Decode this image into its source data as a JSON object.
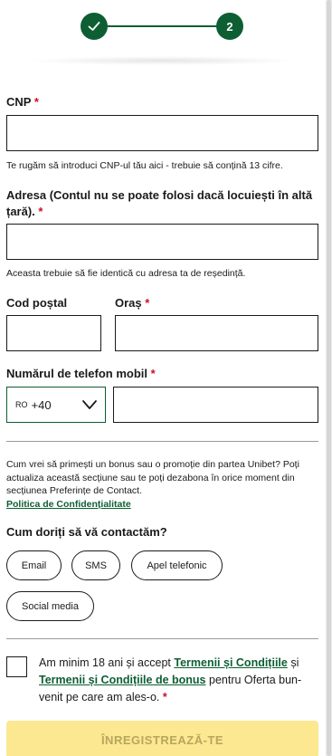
{
  "stepper": {
    "step2_label": "2"
  },
  "cnp": {
    "label": "CNP",
    "required": "*",
    "hint": "Te rugăm să introduci CNP-ul tău aici - trebuie să conțină 13 cifre."
  },
  "address": {
    "label": "Adresa (Contul nu se poate folosi dacă locuiești în altă țară).",
    "required": "*",
    "hint": "Aceasta trebuie să fie identică cu adresa ta de reședință."
  },
  "postal": {
    "label": "Cod poștal"
  },
  "city": {
    "label": "Oraș",
    "required": "*"
  },
  "phone": {
    "label": "Numărul de telefon mobil",
    "required": "*",
    "country_code": "RO",
    "dial_code": "+40"
  },
  "marketing": {
    "info": "Cum vrei să primești un bonus sau o promoție din partea Unibet? Poți actualiza această secțiune sau te poți dezabona în orice moment din secțiunea Preferințe de Contact.",
    "privacy_link": "Politica de Confidențialitate",
    "question": "Cum doriți să vă contactăm?",
    "options": [
      "Email",
      "SMS",
      "Apel telefonic",
      "Social media"
    ]
  },
  "terms": {
    "text_a": "Am minim 18 ani și accept ",
    "link1": "Termenii și Condițiile",
    "text_b": " și ",
    "link2": "Termenii și Condițiile de bonus",
    "text_c": " pentru Oferta bun-venit pe care am ales-o.",
    "required": "*"
  },
  "submit_label": "ÎNREGISTREAZĂ-TE",
  "colors": {
    "brand_green": "#0d5e33",
    "required_red": "#c8102e",
    "submit_bg": "#fbe891"
  }
}
